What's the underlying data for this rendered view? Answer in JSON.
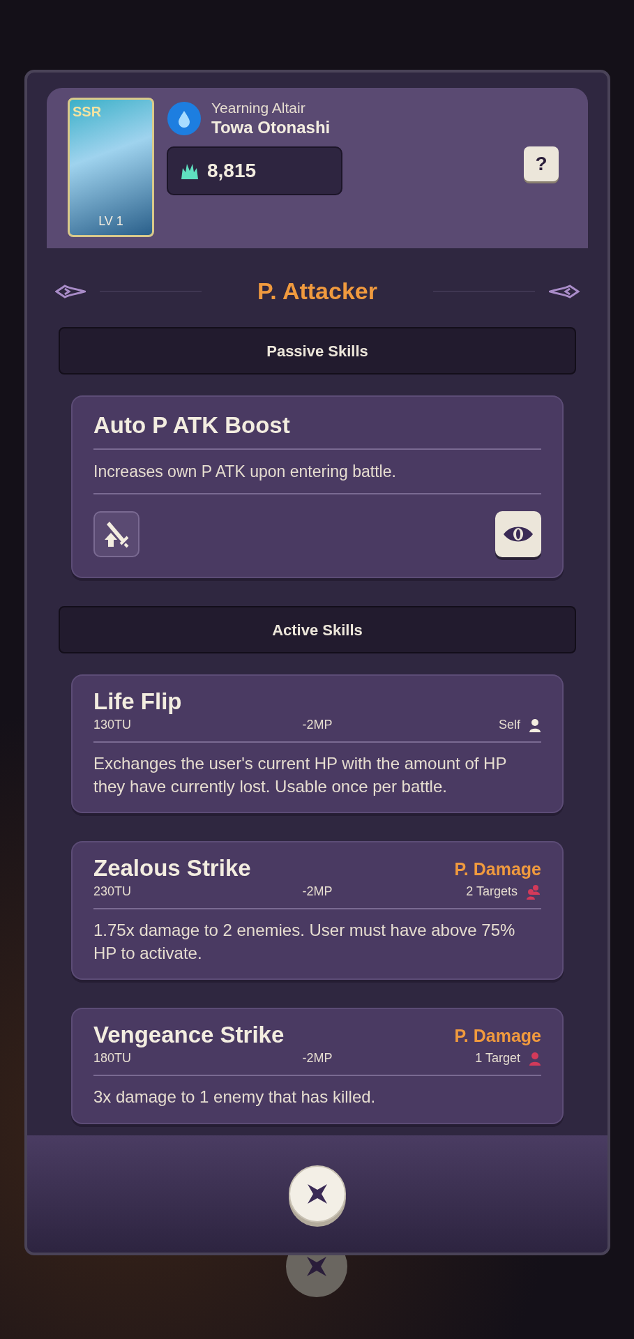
{
  "character": {
    "rarity": "SSR",
    "level": "LV 1",
    "epithet": "Yearning Altair",
    "name": "Towa Otonashi",
    "power": "8,815"
  },
  "help_button": "?",
  "role": "P. Attacker",
  "passive_header": "Passive Skills",
  "passive_skills": [
    {
      "name": "Auto P ATK Boost",
      "description": "Increases own P ATK upon entering battle."
    }
  ],
  "active_header": "Active Skills",
  "active_skills": [
    {
      "name": "Life Flip",
      "cost_tu": "130TU",
      "cost_mp": "-2MP",
      "target": {
        "label": "Self",
        "kind": "self"
      },
      "description": "Exchanges the user's current HP with the amount of HP they have currently lost. Usable once per battle."
    },
    {
      "name": "Zealous Strike",
      "damage_type": "P. Damage",
      "cost_tu": "230TU",
      "cost_mp": "-2MP",
      "target": {
        "label": "2 Targets",
        "kind": "multi"
      },
      "description": "1.75x damage to 2 enemies. User must have above 75% HP to activate."
    },
    {
      "name": "Vengeance Strike",
      "damage_type": "P. Damage",
      "cost_tu": "180TU",
      "cost_mp": "-2MP",
      "target": {
        "label": "1 Target",
        "kind": "single"
      },
      "description": "3x damage to 1 enemy that has killed."
    }
  ]
}
